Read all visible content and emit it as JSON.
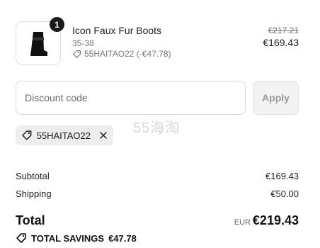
{
  "item": {
    "quantity": "1",
    "name": "Icon Faux Fur Boots",
    "variant": "35-38",
    "discount_line": "55HAITAO22 (-€47.78)",
    "original_price": "€217.21",
    "price": "€169.43",
    "image_icon": "boot-icon"
  },
  "discount": {
    "placeholder": "Discount code",
    "apply_label": "Apply",
    "applied_code": "55HAITAO22"
  },
  "watermark": "55海淘",
  "summary": {
    "subtotal_label": "Subtotal",
    "subtotal_value": "€169.43",
    "shipping_label": "Shipping",
    "shipping_value": "€50.00",
    "total_label": "Total",
    "currency": "EUR",
    "total_value": "€219.43",
    "savings_label": "TOTAL SAVINGS",
    "savings_value": "€47.78"
  },
  "colors": {
    "text": "#1a1a1a",
    "muted": "#777777",
    "border": "#d9d9d9",
    "chip_bg": "#eeeeee",
    "badge_bg": "#1a1a1a"
  }
}
